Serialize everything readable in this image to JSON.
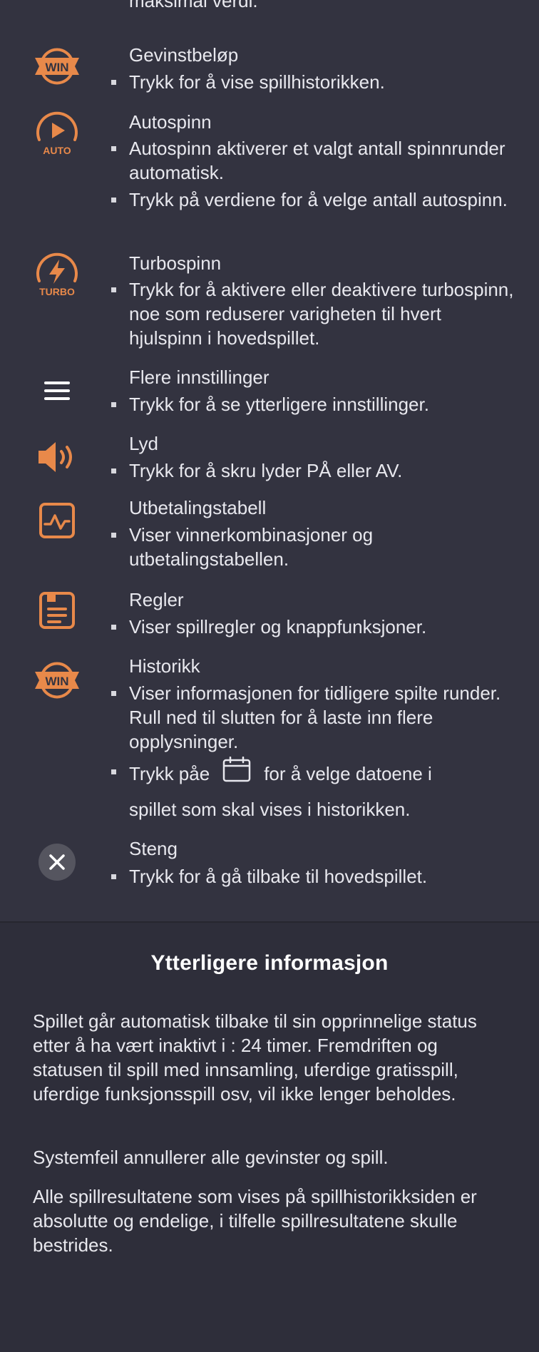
{
  "colors": {
    "accent": "#e8894a",
    "background": "#333340",
    "text": "#e8e8ee"
  },
  "top_cut_text": "maksimal verdi.",
  "items": [
    {
      "icon": "win-badge-icon",
      "title": "Gevinstbeløp",
      "bullets": [
        "Trykk for å vise spillhistorikken."
      ]
    },
    {
      "icon": "autospin-icon",
      "icon_label": "AUTO",
      "title": "Autospinn",
      "bullets": [
        "Autospinn aktiverer et valgt antall spinnrunder automatisk.",
        "Trykk på verdiene for å velge antall autospinn."
      ]
    },
    {
      "icon": "turbo-icon",
      "icon_label": "TURBO",
      "title": "Turbospinn",
      "bullets": [
        "Trykk for å aktivere eller deaktivere turbospinn, noe som reduserer varigheten til hvert hjulspinn i hovedspillet."
      ]
    },
    {
      "icon": "menu-icon",
      "title": "Flere innstillinger",
      "bullets": [
        "Trykk for å se ytterligere innstillinger."
      ]
    },
    {
      "icon": "sound-icon",
      "title": "Lyd",
      "bullets": [
        "Trykk for å skru lyder PÅ eller AV."
      ]
    },
    {
      "icon": "paytable-icon",
      "title": "Utbetalingstabell",
      "bullets": [
        "Viser vinnerkombinasjoner og utbetalingstabellen."
      ]
    },
    {
      "icon": "rules-icon",
      "title": "Regler",
      "bullets": [
        "Viser spillregler og knappfunksjoner."
      ]
    },
    {
      "icon": "history-icon",
      "title": "Historikk",
      "bullets": [
        "Viser informasjonen for tidligere spilte runder. Rull ned til slutten for å laste inn flere opplysninger."
      ],
      "calendar_bullet": {
        "before": "Trykk påe",
        "after": "for å velge datoene i",
        "line2": "spillet som skal vises i historikken."
      }
    },
    {
      "icon": "close-icon",
      "title": "Steng",
      "bullets": [
        "Trykk for å gå tilbake til hovedspillet."
      ]
    }
  ],
  "win_label": "WIN",
  "info": {
    "title": "Ytterligere informasjon",
    "paragraphs": [
      "Spillet går automatisk tilbake til sin opprinnelige status etter å ha vært inaktivt i : 24 timer. Fremdriften og statusen til spill med innsamling, uferdige gratisspill, uferdige funksjonsspill osv, vil ikke lenger beholdes.",
      "Systemfeil annullerer alle gevinster og spill.",
      "Alle spillresultatene som vises på spillhistorikksiden er absolutte og endelige, i tilfelle spillresultatene skulle bestrides."
    ]
  }
}
